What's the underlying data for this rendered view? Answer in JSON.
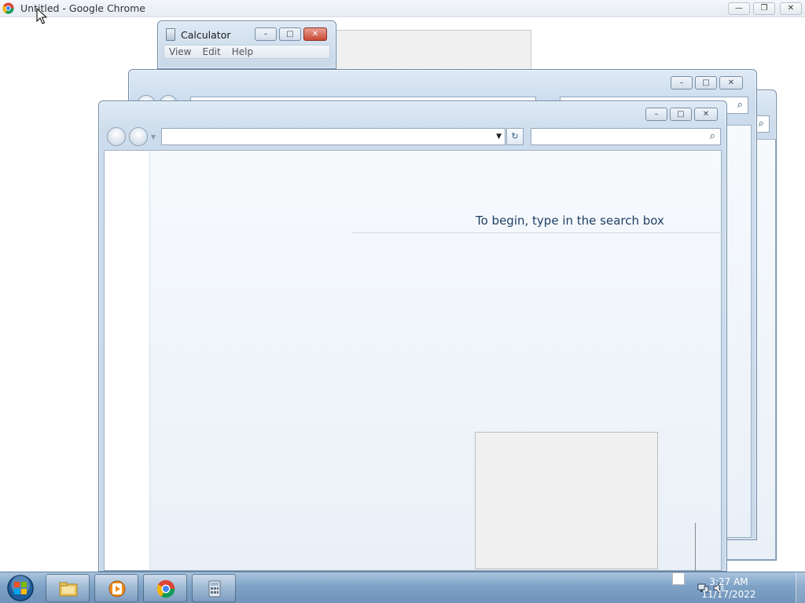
{
  "chrome": {
    "title": "Untitled - Google Chrome",
    "minimize_glyph": "—",
    "restore_glyph": "❐",
    "close_glyph": "✕"
  },
  "calculator": {
    "title": "Calculator",
    "menu": [
      "View",
      "Edit",
      "Help"
    ]
  },
  "explorer": {
    "message": "To begin, type in the search box",
    "refresh_glyph": "↻",
    "search_glyph": "⌕",
    "dropdown_glyph": "▼"
  },
  "window_buttons": {
    "minimize": "–",
    "maximize": "□",
    "close": "✕"
  },
  "taskbar": {
    "items": [
      "windows-explorer",
      "windows-media-player",
      "google-chrome",
      "calculator"
    ],
    "time": "3:27 AM",
    "date": "11/17/2022"
  },
  "colors": {
    "taskbar": "#7fa2c6",
    "message_text": "#1e3f66",
    "close_button": "#c84a34"
  }
}
